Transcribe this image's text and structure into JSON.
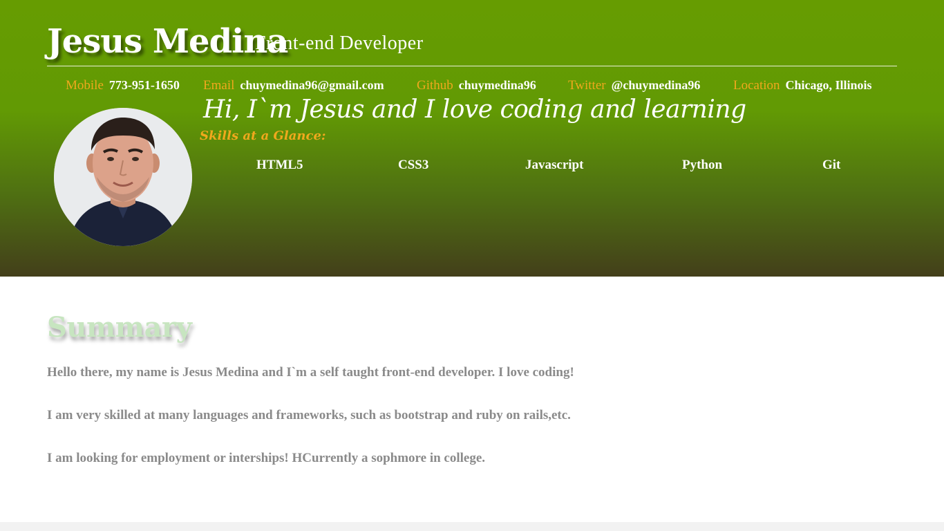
{
  "header": {
    "name": "Jesus Medina",
    "role": "Front-end Developer"
  },
  "contacts": [
    {
      "label": "Mobile",
      "value": "773-951-1650"
    },
    {
      "label": "Email",
      "value": "chuymedina96@gmail.com"
    },
    {
      "label": "Github",
      "value": "chuymedina96"
    },
    {
      "label": "Twitter",
      "value": "@chuymedina96"
    },
    {
      "label": "Location",
      "value": "Chicago, Illinois"
    }
  ],
  "intro": {
    "tagline": "Hi, I`m Jesus and I love coding and learning",
    "skills_heading": "Skills at a Glance:",
    "skills": [
      "HTML5",
      "CSS3",
      "Javascript",
      "Python",
      "Git"
    ]
  },
  "summary": {
    "title": "Summary",
    "paragraphs": [
      "Hello there, my name is Jesus Medina and I`m a self taught front-end developer. I love coding!",
      "I am very skilled at many languages and frameworks, such as bootstrap and ruby on rails,etc.",
      "I am looking for employment or interships! HCurrently a sophmore in college."
    ]
  },
  "colors": {
    "hero_top": "#669c01",
    "hero_bottom": "#433f1a",
    "accent_orange": "#f0a81d",
    "summary_title": "#c7e5c0",
    "body_text": "#8a8a8a"
  },
  "icons": {
    "avatar": "profile-photo"
  }
}
